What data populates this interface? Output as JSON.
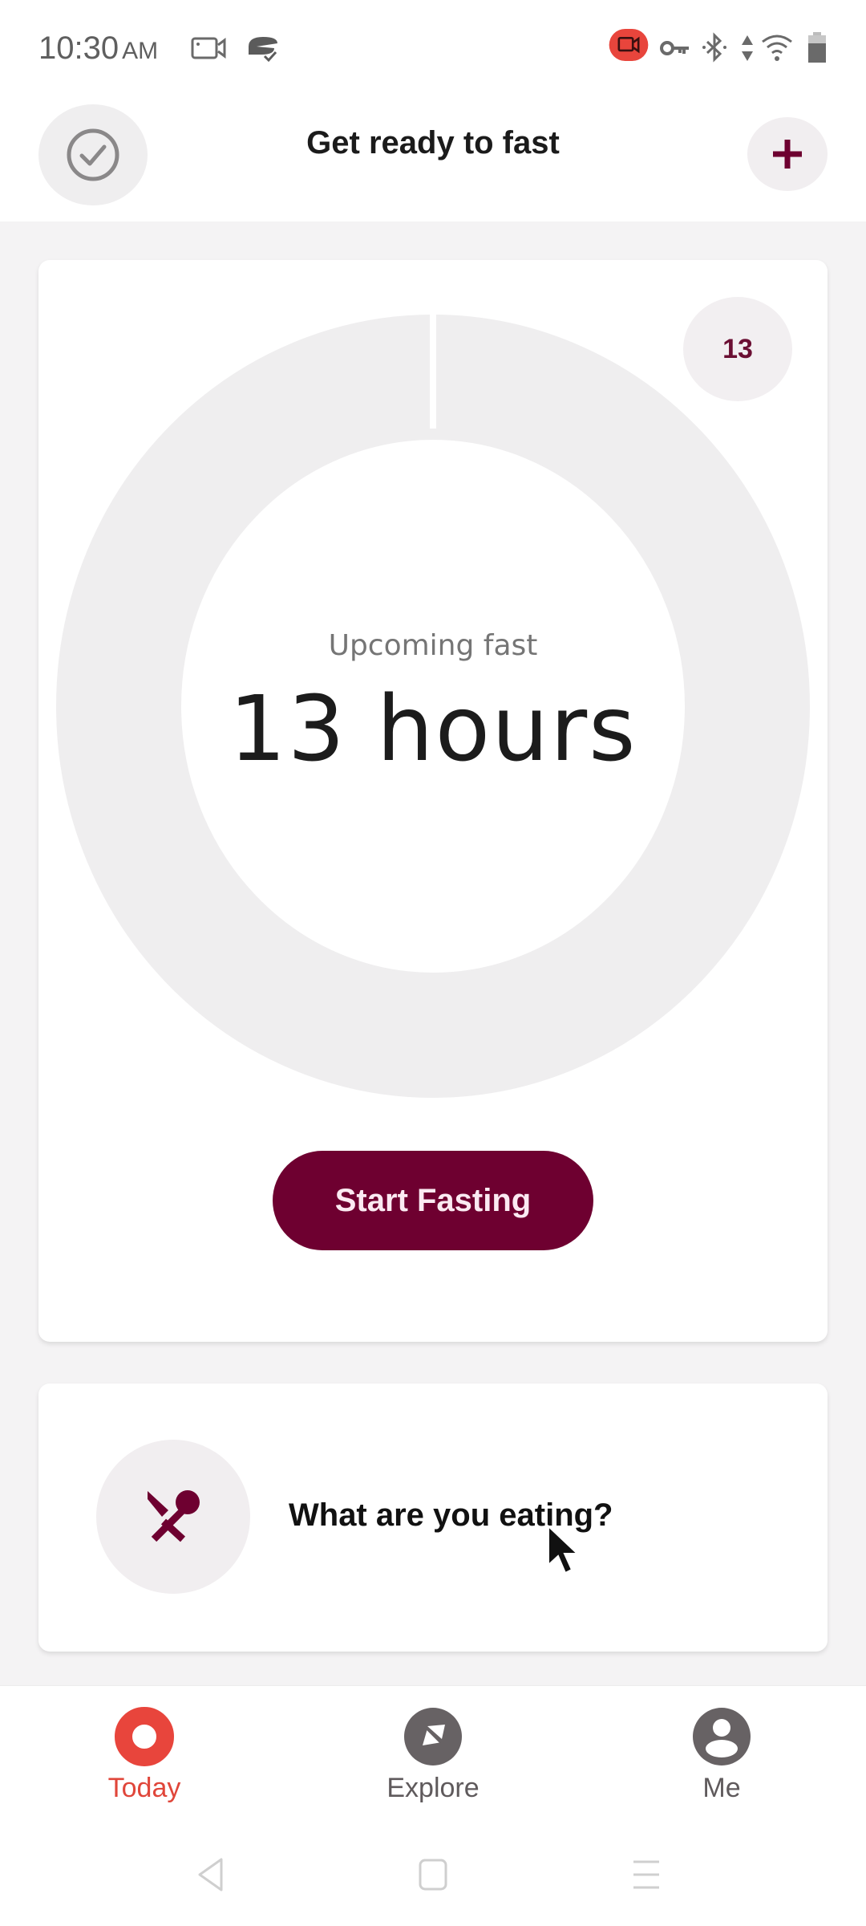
{
  "status_bar": {
    "time": "10:30",
    "ampm": "AM",
    "left_icons": [
      "screen-record-icon",
      "vpn-lock-icon"
    ],
    "right_icons": [
      "recording-indicator-icon",
      "vpn-key-icon",
      "bluetooth-icon",
      "data-transfer-icon",
      "wifi-icon",
      "battery-icon"
    ],
    "recording_color": "#e8453c"
  },
  "header": {
    "title": "Get ready to fast",
    "left_button_icon": "check-circle-icon",
    "right_button_icon": "plus-icon"
  },
  "fast_card": {
    "goal_badge": "13",
    "label": "Upcoming fast",
    "duration": "13 hours",
    "progress_fraction": 0,
    "start_button": "Start Fasting"
  },
  "eating_card": {
    "icon": "cutlery-icon",
    "prompt": "What are you eating?"
  },
  "bottom_nav": {
    "items": [
      {
        "label": "Today",
        "icon": "today-ring-icon",
        "active": true
      },
      {
        "label": "Explore",
        "icon": "compass-icon",
        "active": false
      },
      {
        "label": "Me",
        "icon": "profile-icon",
        "active": false
      }
    ]
  },
  "colors": {
    "brand": "#6e0030",
    "active_tab": "#e0463a",
    "inactive_tab": "#5f5a5c",
    "ring_track": "#efeeef"
  },
  "system_nav": {
    "buttons": [
      "back-icon",
      "home-icon",
      "recents-icon"
    ]
  }
}
